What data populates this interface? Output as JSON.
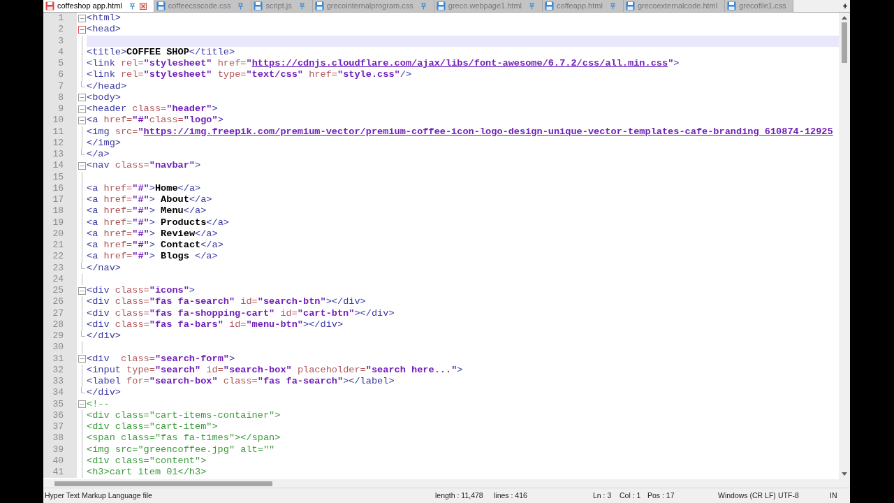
{
  "tabs": [
    {
      "label": "coffeshop app.html",
      "selected": true,
      "modified": true,
      "pinned": true
    },
    {
      "label": "coffeecsscode.css",
      "selected": false,
      "modified": false,
      "pinned": true
    },
    {
      "label": "script.js",
      "selected": false,
      "modified": false,
      "pinned": true
    },
    {
      "label": "grecointernalprogram.css",
      "selected": false,
      "modified": false,
      "pinned": true
    },
    {
      "label": "greco.webpage1.html",
      "selected": false,
      "modified": false,
      "pinned": true
    },
    {
      "label": "coffeapp.html",
      "selected": false,
      "modified": false,
      "pinned": true
    },
    {
      "label": "grecoexternalcode.html",
      "selected": false,
      "modified": false,
      "pinned": false
    },
    {
      "label": "grecofile1.css",
      "selected": false,
      "modified": false,
      "pinned": false
    }
  ],
  "new_tab": "+",
  "lines": [
    {
      "number": "1",
      "kind": "fold_start",
      "selected": false,
      "tokens": [
        {
          "kind": "tag",
          "text": "<html>"
        }
      ]
    },
    {
      "number": "2",
      "kind": "fold_start_current",
      "selected": false,
      "tokens": [
        {
          "kind": "tag",
          "text": "<head>"
        }
      ]
    },
    {
      "number": "3",
      "kind": "fold_body",
      "selected": true
    },
    {
      "number": "4",
      "kind": "fold_body",
      "selected": false,
      "tokens": [
        {
          "kind": "tag",
          "text": "<title>"
        },
        {
          "kind": "text",
          "text": "COFFEE SHOP"
        },
        {
          "kind": "tag",
          "text": "</title>"
        }
      ]
    },
    {
      "number": "5",
      "kind": "fold_body",
      "selected": false,
      "tokens": [
        {
          "kind": "tag",
          "text": "<link"
        },
        {
          "kind": "attr",
          "text": " rel="
        },
        {
          "kind": "value",
          "text": "\"stylesheet\""
        },
        {
          "kind": "attr",
          "text": " href="
        },
        {
          "kind": "value",
          "text": "\""
        },
        {
          "kind": "url",
          "text": "https://cdnjs.cloudflare.com/ajax/libs/font-awesome/6.7.2/css/all.min.css"
        },
        {
          "kind": "value",
          "text": "\""
        },
        {
          "kind": "tag",
          "text": ">"
        }
      ]
    },
    {
      "number": "6",
      "kind": "fold_body",
      "selected": false,
      "tokens": [
        {
          "kind": "tag",
          "text": "<link"
        },
        {
          "kind": "attr",
          "text": " rel="
        },
        {
          "kind": "value",
          "text": "\"stylesheet\""
        },
        {
          "kind": "attr",
          "text": " type="
        },
        {
          "kind": "value",
          "text": "\"text/css\""
        },
        {
          "kind": "attr",
          "text": " href="
        },
        {
          "kind": "value",
          "text": "\"style.css\""
        },
        {
          "kind": "tag",
          "text": "/>"
        }
      ]
    },
    {
      "number": "7",
      "kind": "fold_end",
      "selected": false,
      "tokens": [
        {
          "kind": "tag",
          "text": "</head>"
        }
      ]
    },
    {
      "number": "8",
      "kind": "fold_start",
      "selected": false,
      "tokens": [
        {
          "kind": "tag",
          "text": "<body>"
        }
      ]
    },
    {
      "number": "9",
      "kind": "fold_start",
      "selected": false,
      "tokens": [
        {
          "kind": "tag",
          "text": "<header"
        },
        {
          "kind": "attr",
          "text": " class="
        },
        {
          "kind": "value",
          "text": "\"header\""
        },
        {
          "kind": "tag",
          "text": ">"
        }
      ]
    },
    {
      "number": "10",
      "kind": "fold_start",
      "selected": false,
      "tokens": [
        {
          "kind": "tag",
          "text": "<a"
        },
        {
          "kind": "attr",
          "text": " href="
        },
        {
          "kind": "value",
          "text": "\"#\""
        },
        {
          "kind": "attr",
          "text": "class="
        },
        {
          "kind": "value",
          "text": "\"logo\""
        },
        {
          "kind": "tag",
          "text": ">"
        }
      ]
    },
    {
      "number": "11",
      "kind": "fold_body",
      "selected": false,
      "tokens": [
        {
          "kind": "tag",
          "text": "<img"
        },
        {
          "kind": "attr",
          "text": " src="
        },
        {
          "kind": "value",
          "text": "\""
        },
        {
          "kind": "url",
          "text": "https://img.freepik.com/premium-vector/premium-coffee-icon-logo-design-unique-vector-templates-cafe-branding_610874-12925"
        }
      ]
    },
    {
      "number": "12",
      "kind": "fold_body",
      "selected": false,
      "tokens": [
        {
          "kind": "tag",
          "text": "</img>"
        }
      ]
    },
    {
      "number": "13",
      "kind": "fold_end",
      "selected": false,
      "tokens": [
        {
          "kind": "tag",
          "text": "</a>"
        }
      ]
    },
    {
      "number": "14",
      "kind": "fold_start",
      "selected": false,
      "tokens": [
        {
          "kind": "tag",
          "text": "<nav"
        },
        {
          "kind": "attr",
          "text": " class="
        },
        {
          "kind": "value",
          "text": "\"navbar\""
        },
        {
          "kind": "tag",
          "text": ">"
        }
      ]
    },
    {
      "number": "15",
      "kind": "fold_body",
      "selected": false
    },
    {
      "number": "16",
      "kind": "fold_body",
      "selected": false,
      "tokens": [
        {
          "kind": "tag",
          "text": "<a"
        },
        {
          "kind": "attr",
          "text": " href="
        },
        {
          "kind": "value",
          "text": "\"#\""
        },
        {
          "kind": "tag",
          "text": ">"
        },
        {
          "kind": "text",
          "text": "Home"
        },
        {
          "kind": "tag",
          "text": "</a>"
        }
      ]
    },
    {
      "number": "17",
      "kind": "fold_body",
      "selected": false,
      "tokens": [
        {
          "kind": "tag",
          "text": "<a"
        },
        {
          "kind": "attr",
          "text": " href="
        },
        {
          "kind": "value",
          "text": "\"#\""
        },
        {
          "kind": "tag",
          "text": ">"
        },
        {
          "kind": "text",
          "text": " About"
        },
        {
          "kind": "tag",
          "text": "</a>"
        }
      ]
    },
    {
      "number": "18",
      "kind": "fold_body",
      "selected": false,
      "tokens": [
        {
          "kind": "tag",
          "text": "<a"
        },
        {
          "kind": "attr",
          "text": " href="
        },
        {
          "kind": "value",
          "text": "\"#\""
        },
        {
          "kind": "tag",
          "text": ">"
        },
        {
          "kind": "text",
          "text": " Menu"
        },
        {
          "kind": "tag",
          "text": "</a>"
        }
      ]
    },
    {
      "number": "19",
      "kind": "fold_body",
      "selected": false,
      "tokens": [
        {
          "kind": "tag",
          "text": "<a"
        },
        {
          "kind": "attr",
          "text": " href="
        },
        {
          "kind": "value",
          "text": "\"#\""
        },
        {
          "kind": "tag",
          "text": ">"
        },
        {
          "kind": "text",
          "text": " Products"
        },
        {
          "kind": "tag",
          "text": "</a>"
        }
      ]
    },
    {
      "number": "20",
      "kind": "fold_body",
      "selected": false,
      "tokens": [
        {
          "kind": "tag",
          "text": "<a"
        },
        {
          "kind": "attr",
          "text": " href="
        },
        {
          "kind": "value",
          "text": "\"#\""
        },
        {
          "kind": "tag",
          "text": ">"
        },
        {
          "kind": "text",
          "text": " Review"
        },
        {
          "kind": "tag",
          "text": "</a>"
        }
      ]
    },
    {
      "number": "21",
      "kind": "fold_body",
      "selected": false,
      "tokens": [
        {
          "kind": "tag",
          "text": "<a"
        },
        {
          "kind": "attr",
          "text": " href="
        },
        {
          "kind": "value",
          "text": "\"#\""
        },
        {
          "kind": "tag",
          "text": ">"
        },
        {
          "kind": "text",
          "text": " Contact"
        },
        {
          "kind": "tag",
          "text": "</a>"
        }
      ]
    },
    {
      "number": "22",
      "kind": "fold_body",
      "selected": false,
      "tokens": [
        {
          "kind": "tag",
          "text": "<a"
        },
        {
          "kind": "attr",
          "text": " href="
        },
        {
          "kind": "value",
          "text": "\"#\""
        },
        {
          "kind": "tag",
          "text": ">"
        },
        {
          "kind": "text",
          "text": " Blogs "
        },
        {
          "kind": "tag",
          "text": "</a>"
        }
      ]
    },
    {
      "number": "23",
      "kind": "fold_end",
      "selected": false,
      "tokens": [
        {
          "kind": "tag",
          "text": "</nav>"
        }
      ]
    },
    {
      "number": "24",
      "kind": "fold_body",
      "selected": false
    },
    {
      "number": "25",
      "kind": "fold_start",
      "selected": false,
      "tokens": [
        {
          "kind": "tag",
          "text": "<div"
        },
        {
          "kind": "attr",
          "text": " class="
        },
        {
          "kind": "value",
          "text": "\"icons\""
        },
        {
          "kind": "tag",
          "text": ">"
        }
      ]
    },
    {
      "number": "26",
      "kind": "fold_body",
      "selected": false,
      "tokens": [
        {
          "kind": "tag",
          "text": "<div"
        },
        {
          "kind": "attr",
          "text": " class="
        },
        {
          "kind": "value",
          "text": "\"fas fa-search\""
        },
        {
          "kind": "attr",
          "text": " id="
        },
        {
          "kind": "value",
          "text": "\"search-btn\""
        },
        {
          "kind": "tag",
          "text": "></div>"
        }
      ]
    },
    {
      "number": "27",
      "kind": "fold_body",
      "selected": false,
      "tokens": [
        {
          "kind": "tag",
          "text": "<div"
        },
        {
          "kind": "attr",
          "text": " class="
        },
        {
          "kind": "value",
          "text": "\"fas fa-shopping-cart\""
        },
        {
          "kind": "attr",
          "text": " id="
        },
        {
          "kind": "value",
          "text": "\"cart-btn\""
        },
        {
          "kind": "tag",
          "text": "></div>"
        }
      ]
    },
    {
      "number": "28",
      "kind": "fold_body",
      "selected": false,
      "tokens": [
        {
          "kind": "tag",
          "text": "<div"
        },
        {
          "kind": "attr",
          "text": " class="
        },
        {
          "kind": "value",
          "text": "\"fas fa-bars\""
        },
        {
          "kind": "attr",
          "text": " id="
        },
        {
          "kind": "value",
          "text": "\"menu-btn\""
        },
        {
          "kind": "tag",
          "text": "></div>"
        }
      ]
    },
    {
      "number": "29",
      "kind": "fold_end",
      "selected": false,
      "tokens": [
        {
          "kind": "tag",
          "text": "</div>"
        }
      ]
    },
    {
      "number": "30",
      "kind": "fold_body",
      "selected": false
    },
    {
      "number": "31",
      "kind": "fold_start",
      "selected": false,
      "tokens": [
        {
          "kind": "tag",
          "text": "<div"
        },
        {
          "kind": "attr",
          "text": "  class="
        },
        {
          "kind": "value",
          "text": "\"search-form\""
        },
        {
          "kind": "tag",
          "text": ">"
        }
      ]
    },
    {
      "number": "32",
      "kind": "fold_body",
      "selected": false,
      "tokens": [
        {
          "kind": "tag",
          "text": "<input"
        },
        {
          "kind": "attr",
          "text": " type="
        },
        {
          "kind": "value",
          "text": "\"search\""
        },
        {
          "kind": "attr",
          "text": " id="
        },
        {
          "kind": "value",
          "text": "\"search-box\""
        },
        {
          "kind": "attr",
          "text": " placeholder="
        },
        {
          "kind": "value",
          "text": "\"search here...\""
        },
        {
          "kind": "tag",
          "text": ">"
        }
      ]
    },
    {
      "number": "33",
      "kind": "fold_body",
      "selected": false,
      "tokens": [
        {
          "kind": "tag",
          "text": "<label"
        },
        {
          "kind": "attr",
          "text": " for="
        },
        {
          "kind": "value",
          "text": "\"search-box\""
        },
        {
          "kind": "attr",
          "text": " class="
        },
        {
          "kind": "value",
          "text": "\"fas fa-search\""
        },
        {
          "kind": "tag",
          "text": "></label>"
        }
      ]
    },
    {
      "number": "34",
      "kind": "fold_end",
      "selected": false,
      "tokens": [
        {
          "kind": "tag",
          "text": "</div>"
        }
      ]
    },
    {
      "number": "35",
      "kind": "fold_start",
      "selected": false,
      "tokens": [
        {
          "kind": "comment",
          "text": "<!--"
        }
      ]
    },
    {
      "number": "36",
      "kind": "fold_body",
      "selected": false,
      "tokens": [
        {
          "kind": "comment",
          "text": "<div class=\"cart-items-container\">"
        }
      ]
    },
    {
      "number": "37",
      "kind": "fold_body",
      "selected": false,
      "tokens": [
        {
          "kind": "comment",
          "text": "<div class=\"cart-item\">"
        }
      ]
    },
    {
      "number": "38",
      "kind": "fold_body",
      "selected": false,
      "tokens": [
        {
          "kind": "comment",
          "text": "<span class=\"fas fa-times\"></span>"
        }
      ]
    },
    {
      "number": "39",
      "kind": "fold_body",
      "selected": false,
      "tokens": [
        {
          "kind": "comment",
          "text": "<img src=\"greencoffee.jpg\" alt=\"\""
        }
      ]
    },
    {
      "number": "40",
      "kind": "fold_body",
      "selected": false,
      "tokens": [
        {
          "kind": "comment",
          "text": "<div class=\"content\">"
        }
      ]
    },
    {
      "number": "41",
      "kind": "fold_body",
      "selected": false,
      "tokens": [
        {
          "kind": "comment",
          "text": "<h3>cart item 01</h3>"
        }
      ]
    }
  ],
  "status_bar": {
    "file_type": "Hyper Text Markup Language file",
    "length": "length : 11,478",
    "lines": "lines : 416",
    "line": "Ln : 3",
    "column": "Col : 1",
    "position": "Pos : 17",
    "eol": "Windows (CR LF)",
    "encoding": "UTF-8",
    "mode": "IN"
  }
}
